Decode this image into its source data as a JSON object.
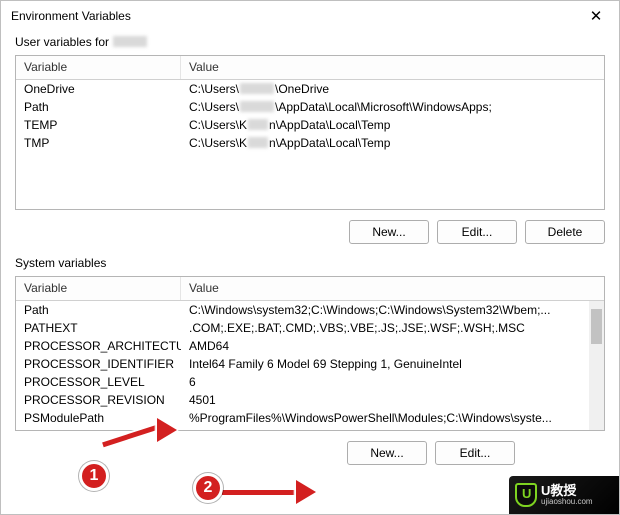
{
  "window": {
    "title": "Environment Variables",
    "close_glyph": "✕"
  },
  "user_section": {
    "label_prefix": "User variables for ",
    "label_user_redacted": true,
    "columns": {
      "variable": "Variable",
      "value": "Value"
    },
    "rows": [
      {
        "variable": "OneDrive",
        "value_prefix": "C:\\Users\\",
        "value_mid_redacted": true,
        "value_suffix": "\\OneDrive"
      },
      {
        "variable": "Path",
        "value_prefix": "C:\\Users\\",
        "value_mid_redacted": true,
        "value_suffix": "\\AppData\\Local\\Microsoft\\WindowsApps;"
      },
      {
        "variable": "TEMP",
        "value_prefix": "C:\\Users\\K",
        "value_mid_redacted": true,
        "value_suffix": "n\\AppData\\Local\\Temp"
      },
      {
        "variable": "TMP",
        "value_prefix": "C:\\Users\\K",
        "value_mid_redacted": true,
        "value_suffix": "n\\AppData\\Local\\Temp"
      }
    ],
    "buttons": {
      "new": "New...",
      "edit": "Edit...",
      "delete": "Delete"
    }
  },
  "system_section": {
    "label": "System variables",
    "columns": {
      "variable": "Variable",
      "value": "Value"
    },
    "rows": [
      {
        "variable": "Path",
        "value": "C:\\Windows\\system32;C:\\Windows;C:\\Windows\\System32\\Wbem;..."
      },
      {
        "variable": "PATHEXT",
        "value": ".COM;.EXE;.BAT;.CMD;.VBS;.VBE;.JS;.JSE;.WSF;.WSH;.MSC"
      },
      {
        "variable": "PROCESSOR_ARCHITECTURE",
        "value": "AMD64"
      },
      {
        "variable": "PROCESSOR_IDENTIFIER",
        "value": "Intel64 Family 6 Model 69 Stepping 1, GenuineIntel"
      },
      {
        "variable": "PROCESSOR_LEVEL",
        "value": "6"
      },
      {
        "variable": "PROCESSOR_REVISION",
        "value": "4501"
      },
      {
        "variable": "PSModulePath",
        "value": "%ProgramFiles%\\WindowsPowerShell\\Modules;C:\\Windows\\syste..."
      }
    ],
    "buttons": {
      "new": "New...",
      "edit": "Edit..."
    }
  },
  "annotation": {
    "marker1": "1",
    "marker2": "2"
  },
  "watermark": {
    "line1": "U教授",
    "line2": "ujiaoshou.com"
  }
}
